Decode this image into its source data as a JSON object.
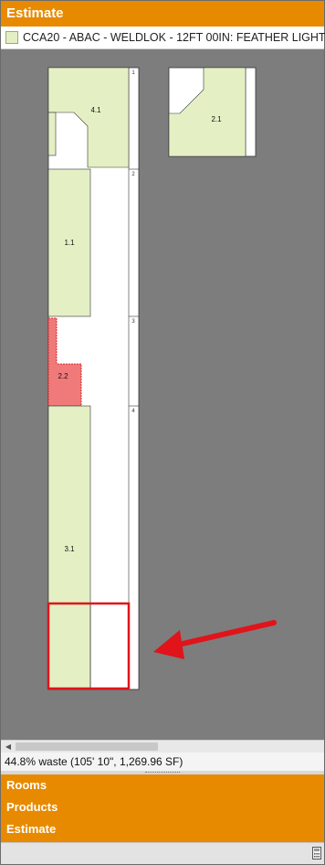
{
  "panel": {
    "title": "Estimate"
  },
  "material": {
    "label": "CCA20 - ABAC - WELDLOK - 12FT 00IN: FEATHER LIGHT",
    "swatch_color": "#e4f0c4"
  },
  "canvas": {
    "background_color": "#7d7d7d",
    "room_fill_color": "#e4f0c4",
    "selected_room_fill_color": "#f07a7a",
    "highlight_color": "#e0141a",
    "rooms": [
      {
        "label": "4.1"
      },
      {
        "label": "2.1"
      },
      {
        "label": "1.1"
      },
      {
        "label": "2.2"
      },
      {
        "label": "3.1"
      }
    ],
    "strip_markers": [
      "1",
      "2",
      "3",
      "4"
    ]
  },
  "status": {
    "waste_text": "44.8% waste (105' 10\", 1,269.96 SF)"
  },
  "nav": {
    "items": [
      "Rooms",
      "Products",
      "Estimate"
    ]
  },
  "colors": {
    "accent": "#e88a00"
  }
}
